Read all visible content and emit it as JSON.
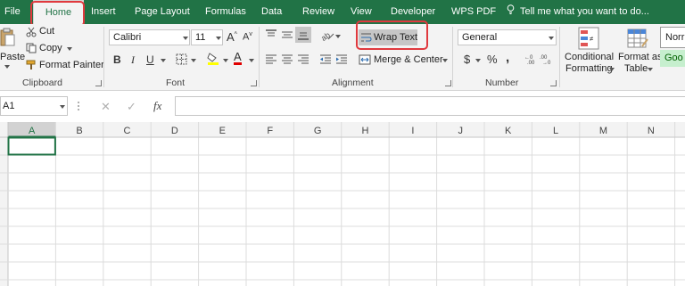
{
  "tabs": [
    {
      "label": "File",
      "active": false
    },
    {
      "label": "Home",
      "active": true
    },
    {
      "label": "Insert",
      "active": false
    },
    {
      "label": "Page Layout",
      "active": false
    },
    {
      "label": "Formulas",
      "active": false
    },
    {
      "label": "Data",
      "active": false
    },
    {
      "label": "Review",
      "active": false
    },
    {
      "label": "View",
      "active": false
    },
    {
      "label": "Developer",
      "active": false
    },
    {
      "label": "WPS PDF",
      "active": false
    }
  ],
  "tell_me": "Tell me what you want to do...",
  "clipboard": {
    "paste": "Paste",
    "cut": "Cut",
    "copy": "Copy",
    "format_painter": "Format Painter",
    "group_label": "Clipboard"
  },
  "font": {
    "name": "Calibri",
    "size": "11",
    "bold": "B",
    "italic": "I",
    "underline": "U",
    "grow": "A",
    "shrink": "A",
    "font_color_glyph": "A",
    "group_label": "Font"
  },
  "alignment": {
    "wrap_text": "Wrap Text",
    "merge_center": "Merge & Center",
    "group_label": "Alignment"
  },
  "number": {
    "format": "General",
    "currency": "$",
    "percent": "%",
    "comma": ",",
    "group_label": "Number"
  },
  "styles": {
    "conditional_line1": "Conditional",
    "conditional_line2": "Formatting",
    "format_table_line1": "Format as",
    "format_table_line2": "Table",
    "normal": "Norr",
    "good": "Goo"
  },
  "formula_bar": {
    "name_box": "A1",
    "cancel": "✕",
    "enter": "✓",
    "fx": "fx",
    "formula": ""
  },
  "columns": [
    "A",
    "B",
    "C",
    "D",
    "E",
    "F",
    "G",
    "H",
    "I",
    "J",
    "K",
    "L",
    "M",
    "N"
  ],
  "colors": {
    "brand": "#217346",
    "highlight": "#e0393e",
    "good_fill": "#c6efce",
    "good_text": "#006100"
  }
}
